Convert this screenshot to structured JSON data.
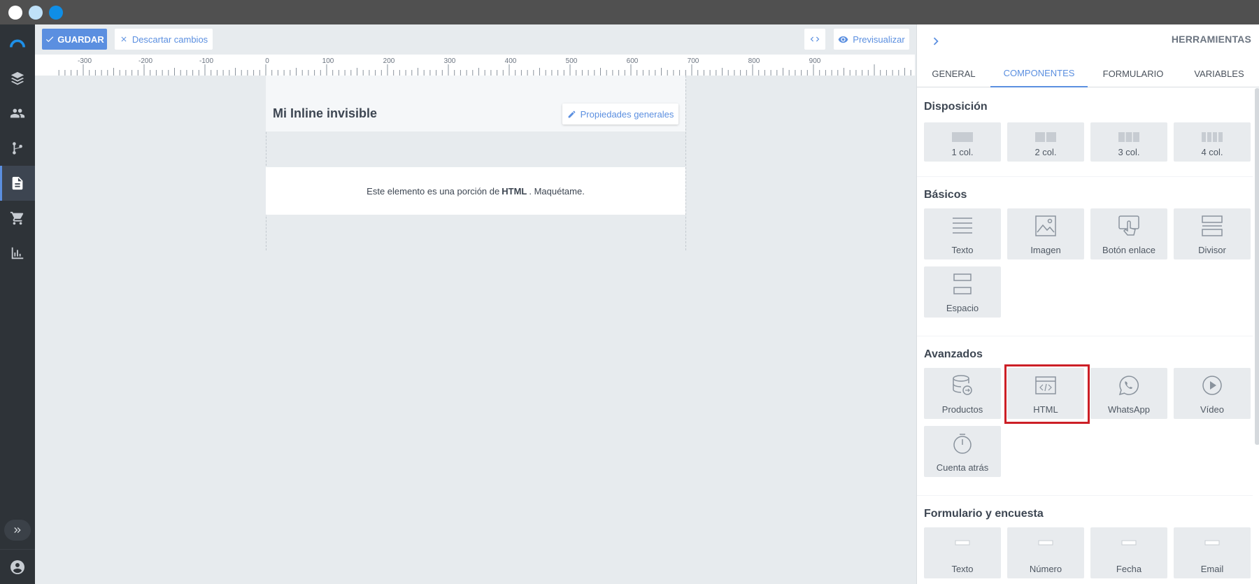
{
  "toolbar": {
    "save_label": "GUARDAR",
    "discard_label": "Descartar cambios",
    "preview_label": "Previsualizar"
  },
  "ruler": {
    "ticks": [
      "-300",
      "-200",
      "-100",
      "0",
      "100",
      "200",
      "300",
      "400",
      "500",
      "600",
      "700",
      "800",
      "900"
    ]
  },
  "canvas": {
    "title": "Mi Inline invisible",
    "props_label": "Propiedades generales",
    "html_text_before": "Este elemento es una porción de",
    "html_text_bold": "HTML",
    "html_text_after": ". Maquétame."
  },
  "panel": {
    "title": "HERRAMIENTAS",
    "tabs": [
      {
        "label": "GENERAL",
        "active": false
      },
      {
        "label": "COMPONENTES",
        "active": true
      },
      {
        "label": "FORMULARIO",
        "active": false
      },
      {
        "label": "VARIABLES",
        "active": false
      }
    ],
    "sections": [
      {
        "title": "Disposición",
        "items": [
          "1 col.",
          "2 col.",
          "3 col.",
          "4 col."
        ]
      },
      {
        "title": "Básicos",
        "items": [
          "Texto",
          "Imagen",
          "Botón enlace",
          "Divisor",
          "Espacio"
        ]
      },
      {
        "title": "Avanzados",
        "items": [
          "Productos",
          "HTML",
          "WhatsApp",
          "Vídeo",
          "Cuenta atrás"
        ]
      },
      {
        "title": "Formulario y encuesta",
        "items": [
          "Texto",
          "Número",
          "Fecha",
          "Email"
        ]
      }
    ]
  },
  "colors": {
    "accent": "#5b8fe0",
    "sidebar": "#2e3338",
    "highlight": "#cc1f26"
  },
  "sidebar": {
    "icons": [
      "logo-icon",
      "layers-icon",
      "contacts-icon",
      "flow-icon",
      "document-icon",
      "cart-icon",
      "chart-icon"
    ],
    "active_index": 4
  }
}
